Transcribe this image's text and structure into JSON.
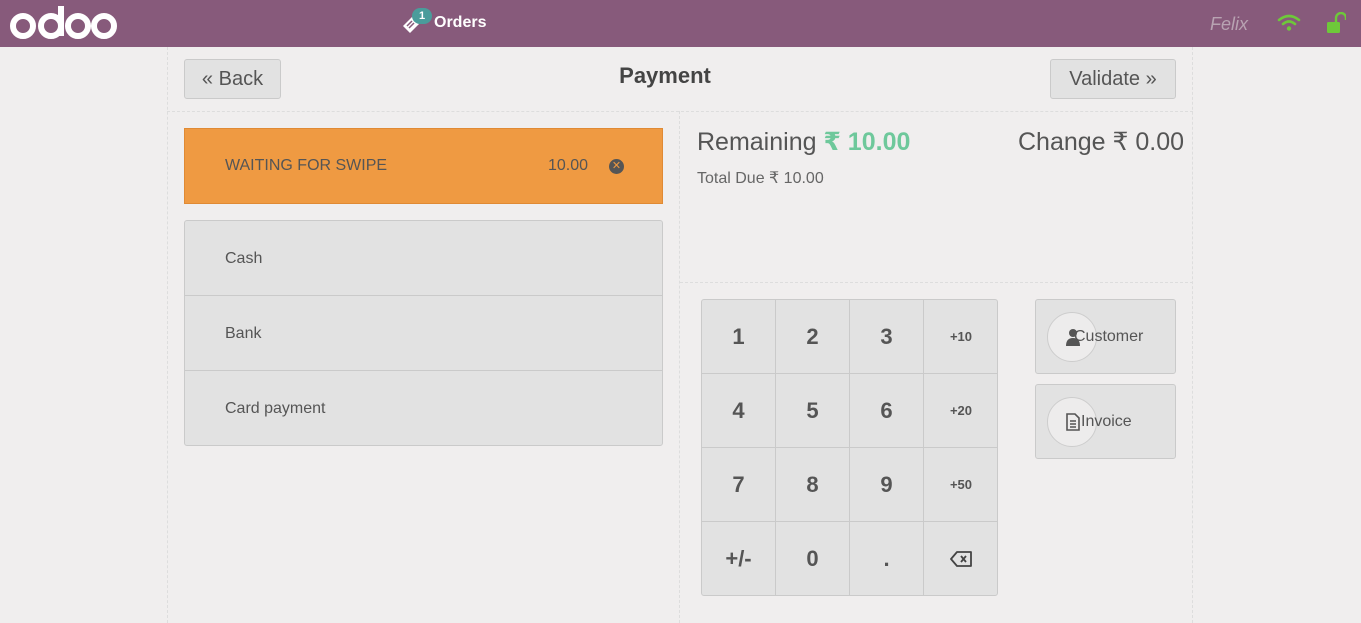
{
  "header": {
    "logo_text": "odoo",
    "orders_label": "Orders",
    "orders_count": "1",
    "user_name": "Felix"
  },
  "nav": {
    "back_label": "« Back",
    "title": "Payment",
    "validate_label": "Validate »"
  },
  "paymentlines": [
    {
      "name": "WAITING FOR SWIPE",
      "amount": "10.00",
      "status_color": "#ef9a42"
    }
  ],
  "payment_methods": [
    "Cash",
    "Bank",
    "Card payment"
  ],
  "summary": {
    "remaining_label": "Remaining",
    "remaining_amount": "₹ 10.00",
    "change_label": "Change",
    "change_amount": "₹ 0.00",
    "total_due_label": "Total Due",
    "total_due_amount": "₹ 10.00"
  },
  "numpad": [
    "1",
    "2",
    "3",
    "+10",
    "4",
    "5",
    "6",
    "+20",
    "7",
    "8",
    "9",
    "+50",
    "+/-",
    "0",
    "."
  ],
  "side_buttons": {
    "customer_label": "Customer",
    "invoice_label": "Invoice"
  },
  "colors": {
    "topbar": "#875a7b",
    "remaining_amount": "#6ec89b",
    "wifi": "#6ec83a",
    "lock": "#6ec83a"
  },
  "icons": [
    "ticket-icon",
    "wifi-icon",
    "unlock-icon",
    "remove-circle-icon",
    "backspace-icon",
    "user-icon",
    "file-icon"
  ]
}
